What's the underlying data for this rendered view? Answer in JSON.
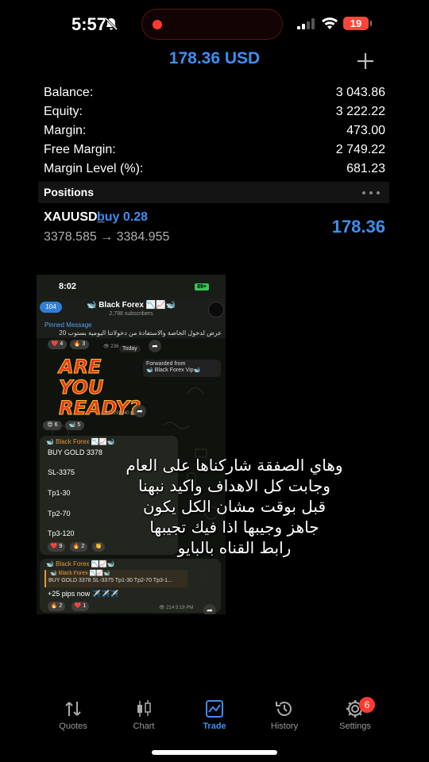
{
  "status": {
    "time": "5:57",
    "battery": "19"
  },
  "header": {
    "total_profit": "178.36 USD"
  },
  "account": [
    {
      "label": "Balance:",
      "value": "3 043.86"
    },
    {
      "label": "Equity:",
      "value": "3 222.22"
    },
    {
      "label": "Margin:",
      "value": "473.00"
    },
    {
      "label": "Free Margin:",
      "value": "2 749.22"
    },
    {
      "label": "Margin Level (%):",
      "value": "681.23"
    }
  ],
  "positions": {
    "title": "Positions",
    "items": [
      {
        "symbol": "XAUUSD_",
        "type": "buy 0.28",
        "prices": "3378.585 → 3384.955",
        "profit": "178.36"
      }
    ]
  },
  "embedded": {
    "time": "8:02",
    "battery": "89+",
    "back_count": "104",
    "channel": "🐋 Black Forex 📉📈🐋",
    "subscribers": "2,798 subscribers",
    "pinned_label": "Pinned Message",
    "pinned_text": "عرض لدخول الخاصة والاستفادة من دخولاتنا اليومية بستوب 20",
    "reactions1": [
      "❤️ 4",
      "🔥 3"
    ],
    "views1": "👁 236",
    "today": "Today",
    "forwarded_from": "Forwarded from",
    "forwarded_name": "🐋 Black Forex Vip🐋",
    "ready_text": [
      "ARE",
      "YOU",
      "READY?"
    ],
    "ready_time": "👁 229 4:40 PM",
    "reactions2": [
      "😍 6",
      "🐋 5"
    ],
    "msg1": {
      "name": "🐋 Black Forex 📉📈🐋",
      "lines": [
        "BUY GOLD 3378",
        "SL-3375",
        "Tp1-30",
        "Tp2-70",
        "Tp3-120"
      ],
      "reactions": [
        "❤️ 9",
        "🔥 2",
        "👏"
      ]
    },
    "msg2": {
      "name": "🐋 Black Forex 📉📈🐋",
      "quote_name": "🐋 Black Forex 📉📈🐋",
      "quote_text": "BUY GOLD 3378 SL-3375 Tp1-30 Tp2-70 Tp3-1...",
      "text": "+25 pips now ✈️✈️✈️",
      "reactions": [
        "🔥 2",
        "❤️ 1"
      ],
      "meta": "👁 214 5:19 PM"
    }
  },
  "overlay": [
    "وهاي الصفقة شاركناها على العام",
    "وجابت كل الاهداف واكيد نبهنا",
    "قبل بوقت مشان الكل يكون",
    "جاهز وجيبها اذا فيك تجيبها",
    "رابط القناه بالبايو"
  ],
  "tabs": [
    {
      "label": "Quotes",
      "icon": "quotes-icon"
    },
    {
      "label": "Chart",
      "icon": "chart-icon"
    },
    {
      "label": "Trade",
      "icon": "trade-icon",
      "active": true
    },
    {
      "label": "History",
      "icon": "history-icon"
    },
    {
      "label": "Settings",
      "icon": "settings-icon"
    }
  ],
  "settings_badge": "6",
  "colors": {
    "accent": "#3f8ef0",
    "badge": "#ff3b30",
    "background": "#000000"
  }
}
